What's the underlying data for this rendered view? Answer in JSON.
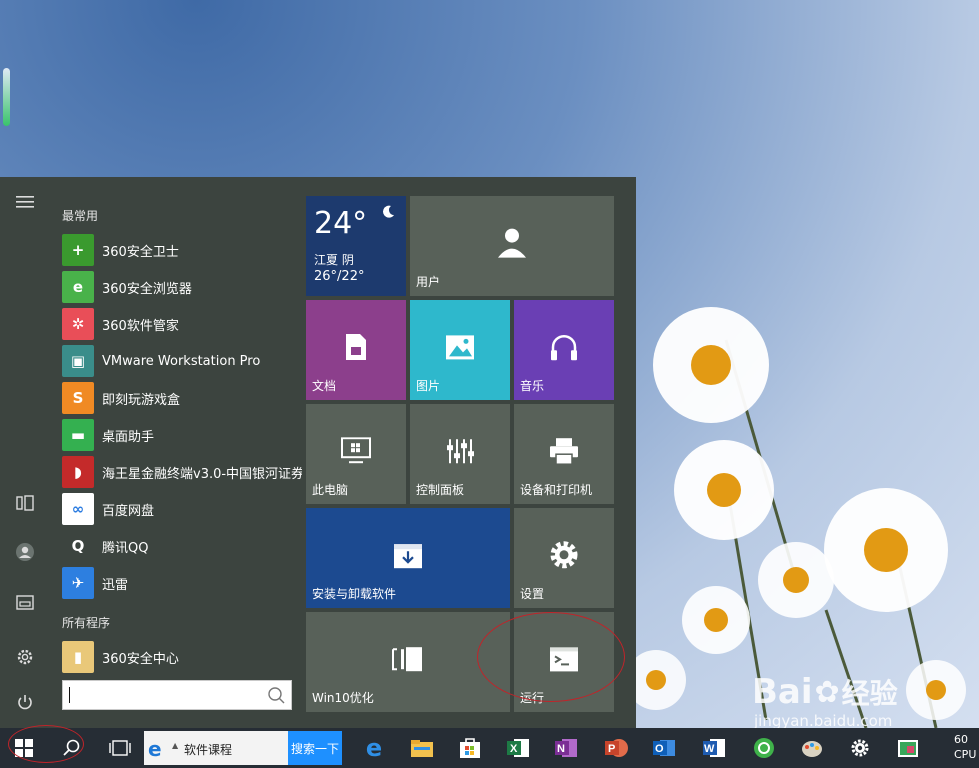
{
  "weather": {
    "temp": "24°",
    "city": "江夏 阴",
    "range": "26°/22°"
  },
  "frequent_header": "最常用",
  "apps": [
    {
      "label": "360安全卫士",
      "color": "#3a9a2e",
      "glyph": "+"
    },
    {
      "label": "360安全浏览器",
      "color": "#49b24a",
      "glyph": "e"
    },
    {
      "label": "360软件管家",
      "color": "#e94e58",
      "glyph": "✲"
    },
    {
      "label": "VMware Workstation Pro",
      "color": "#3a8d8a",
      "glyph": "▣"
    },
    {
      "label": "即刻玩游戏盒",
      "color": "#f08a24",
      "glyph": "S"
    },
    {
      "label": "桌面助手",
      "color": "#34b050",
      "glyph": "▬"
    },
    {
      "label": "海王星金融终端v3.0-中国银河证券",
      "color": "#c42a2a",
      "glyph": "◗"
    },
    {
      "label": "百度网盘",
      "color": "#ffffff",
      "glyph": "∞"
    },
    {
      "label": "腾讯QQ",
      "color": "#3c443f",
      "glyph": "Q"
    },
    {
      "label": "迅雷",
      "color": "#2d7fe0",
      "glyph": "✈"
    }
  ],
  "all_programs_header": "所有程序",
  "all_programs": [
    {
      "label": "360安全中心",
      "color": "#e9c879",
      "glyph": "▮"
    }
  ],
  "tiles": {
    "user": "用户",
    "docs": "文档",
    "pictures": "图片",
    "music": "音乐",
    "this_pc": "此电脑",
    "control_panel": "控制面板",
    "devices": "设备和打印机",
    "install": "安装与卸载软件",
    "settings": "设置",
    "win10": "Win10优化",
    "run": "运行"
  },
  "colors": {
    "weather": "#1d3a6e",
    "gray_tile": "#586159",
    "docs": "#8c3f8c",
    "pictures": "#2eb8cc",
    "music": "#6a3fb4",
    "install": "#1c4a90"
  },
  "taskbar": {
    "ie_text": "软件课程",
    "search_button": "搜索一下",
    "clock_top": "60",
    "clock_bottom": "CPU"
  },
  "watermark": {
    "brand": "Bai",
    "brand2": "经验",
    "url": "jingyan.baidu.com"
  }
}
